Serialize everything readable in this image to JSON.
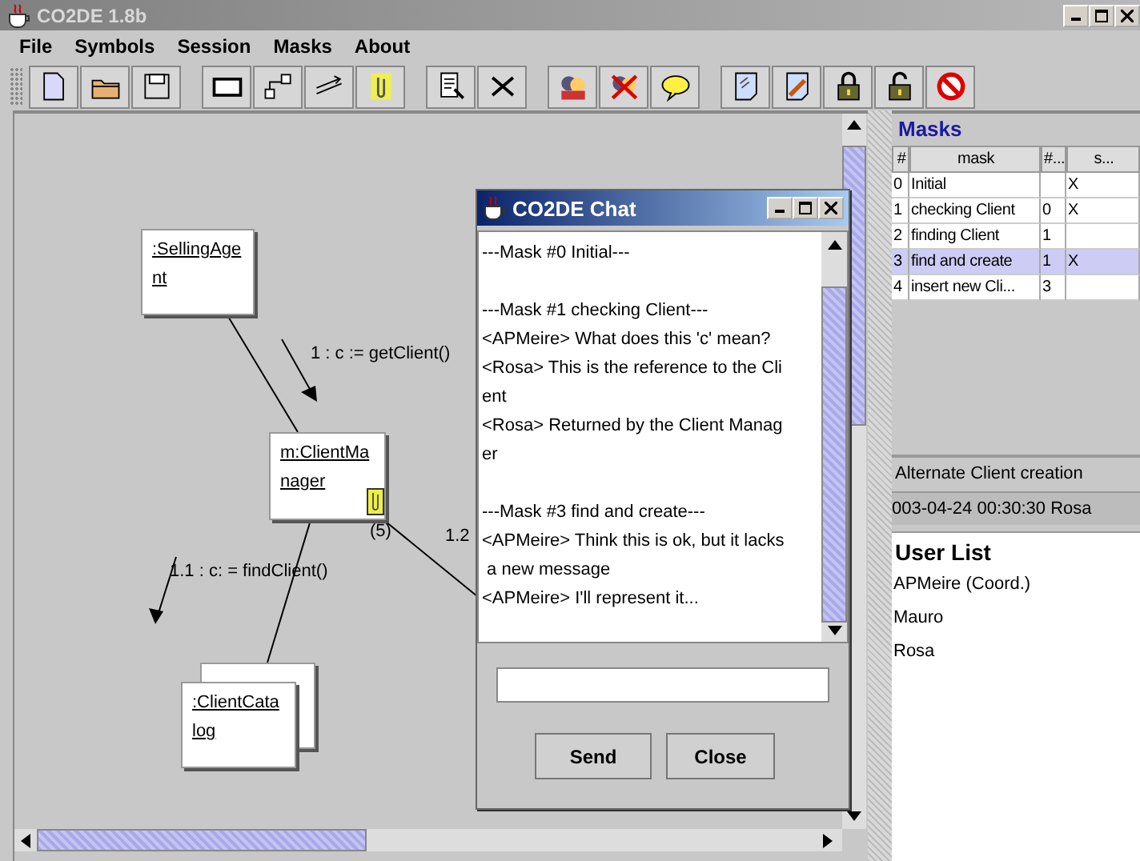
{
  "window": {
    "title": "CO2DE 1.8b"
  },
  "menu": [
    "File",
    "Symbols",
    "Session",
    "Masks",
    "About"
  ],
  "diagram": {
    "nodes": [
      {
        "kind": "object",
        "lines": [
          ":SellingAge",
          "nt"
        ]
      },
      {
        "kind": "object",
        "lines": [
          "m:ClientMa",
          "nager"
        ],
        "attachment": true,
        "note_count": "(5)"
      },
      {
        "kind": "multiobject",
        "lines": [
          ":ClientCata",
          "log"
        ]
      }
    ],
    "messages": [
      "1 : c := getClient()",
      "1.1 : c: = findClient()",
      "1.2"
    ]
  },
  "chat": {
    "title": "CO2DE Chat",
    "sections": [
      [
        "---Mask #0 Initial---"
      ],
      [
        "---Mask #1 checking Client---",
        "<APMeire> What does this 'c' mean?",
        "<Rosa> This is the reference to the Cli",
        "ent",
        "<Rosa> Returned by the Client Manag",
        "er"
      ],
      [
        "---Mask #3 find and create---",
        "<APMeire> Think this is ok, but it lacks",
        " a new message",
        "<APMeire> I'll represent it..."
      ]
    ],
    "buttons": [
      "Send",
      "Close"
    ]
  },
  "masks": {
    "title": "Masks",
    "columns": [
      "#",
      "mask",
      "#...",
      "s..."
    ],
    "rows": [
      {
        "num": "0",
        "mask": "Initial",
        "s": "X",
        "selected": false
      },
      {
        "num": "1",
        "mask": "checking Client",
        "parent": "0",
        "s": "X",
        "selected": false
      },
      {
        "num": "2",
        "mask": "finding Client",
        "parent": "1",
        "selected": false
      },
      {
        "num": "3",
        "mask": "find and create",
        "parent": "1",
        "s": "X",
        "selected": true
      },
      {
        "num": "4",
        "mask": "insert new Cli...",
        "parent": "3",
        "selected": false
      }
    ],
    "description": "Alternate Client creation",
    "timestamp": "003-04-24 00:30:30 Rosa"
  },
  "user_list": {
    "title": "User List",
    "users": [
      "APMeire (Coord.)",
      "Mauro",
      "Rosa"
    ]
  }
}
